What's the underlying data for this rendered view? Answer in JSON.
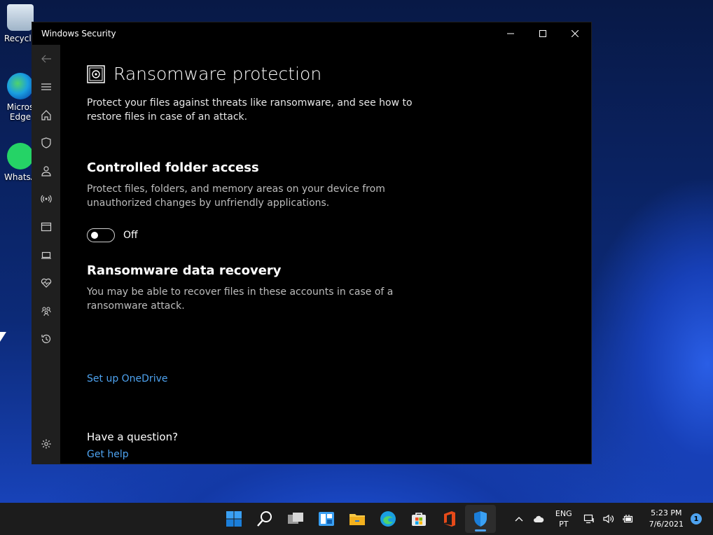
{
  "desktop": {
    "icons": [
      {
        "label": "Recycle"
      },
      {
        "label": "Micros Edge"
      },
      {
        "label": "WhatsA"
      }
    ]
  },
  "window": {
    "title": "Windows Security",
    "minimize_icon": "minimize-icon",
    "maximize_icon": "maximize-icon",
    "close_icon": "close-icon"
  },
  "nav": {
    "items": [
      {
        "icon": "back-arrow-icon"
      },
      {
        "icon": "hamburger-menu-icon"
      },
      {
        "icon": "home-icon"
      },
      {
        "icon": "shield-icon"
      },
      {
        "icon": "person-icon"
      },
      {
        "icon": "wireless-icon"
      },
      {
        "icon": "app-browser-icon"
      },
      {
        "icon": "laptop-icon"
      },
      {
        "icon": "heart-pulse-icon"
      },
      {
        "icon": "family-icon"
      },
      {
        "icon": "history-icon"
      }
    ],
    "settings_icon": "gear-icon"
  },
  "page": {
    "title": "Ransomware protection",
    "description": "Protect your files against threats like ransomware, and see how to restore files in case of an attack.",
    "cfa": {
      "title": "Controlled folder access",
      "description": "Protect files, folders, and memory areas on your device from unauthorized changes by unfriendly applications.",
      "toggle_label": "Off"
    },
    "recovery": {
      "title": "Ransomware data recovery",
      "description": "You may be able to recover files in these accounts in case of a ransomware attack.",
      "link": "Set up OneDrive"
    },
    "help": {
      "question": "Have a question?",
      "link": "Get help"
    }
  },
  "taskbar": {
    "apps": [
      "start-icon",
      "search-icon",
      "task-view-icon",
      "widgets-icon",
      "file-explorer-icon",
      "edge-icon",
      "store-icon",
      "office-icon",
      "windows-security-icon"
    ],
    "tray": {
      "lang_line1": "ENG",
      "lang_line2": "PT",
      "time": "5:23 PM",
      "date": "7/6/2021",
      "notifications": "1"
    }
  },
  "colors": {
    "accent": "#4ea3f0",
    "window_bg": "#000000",
    "nav_bg": "#1f1f1f",
    "taskbar_bg": "#1c1c1c"
  }
}
